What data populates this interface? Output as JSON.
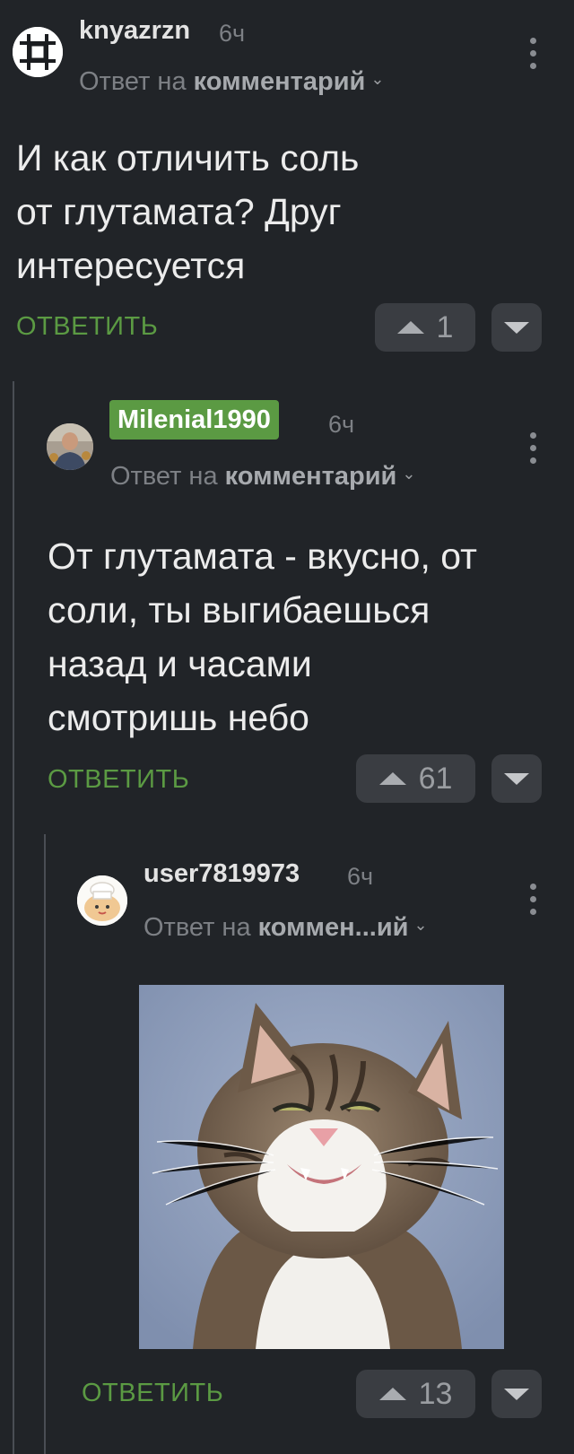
{
  "comments": [
    {
      "username": "knyazrzn",
      "time": "6ч",
      "reply_prefix": "Ответ на",
      "reply_target": "комментарий",
      "text_lines": [
        "И как отличить соль",
        "от глутамата? Друг",
        "интересуется"
      ],
      "reply_label": "ОТВЕТИТЬ",
      "rating": "1"
    },
    {
      "username": "Milenial1990",
      "time": "6ч",
      "reply_prefix": "Ответ на",
      "reply_target": "комментарий",
      "text_lines": [
        "От глутамата - вкусно, от",
        "соли, ты выгибаешься",
        "назад и часами",
        "смотришь небо"
      ],
      "reply_label": "ОТВЕТИТЬ",
      "rating": "61"
    },
    {
      "username": "user7819973",
      "time": "6ч",
      "reply_prefix": "Ответ на",
      "reply_target": "коммен...ий",
      "image": "smiling-cat-photo",
      "reply_label": "ОТВЕТИТЬ",
      "rating": "13"
    }
  ],
  "icons": {
    "more": "more-vertical-icon",
    "upvote": "triangle-up-icon",
    "downvote": "triangle-down-icon",
    "chevron": "chevron-down-icon"
  },
  "colors": {
    "background": "#212428",
    "accent_green": "#5b9a43",
    "button_bg": "#3a3d42",
    "muted_text": "#7d8085"
  }
}
